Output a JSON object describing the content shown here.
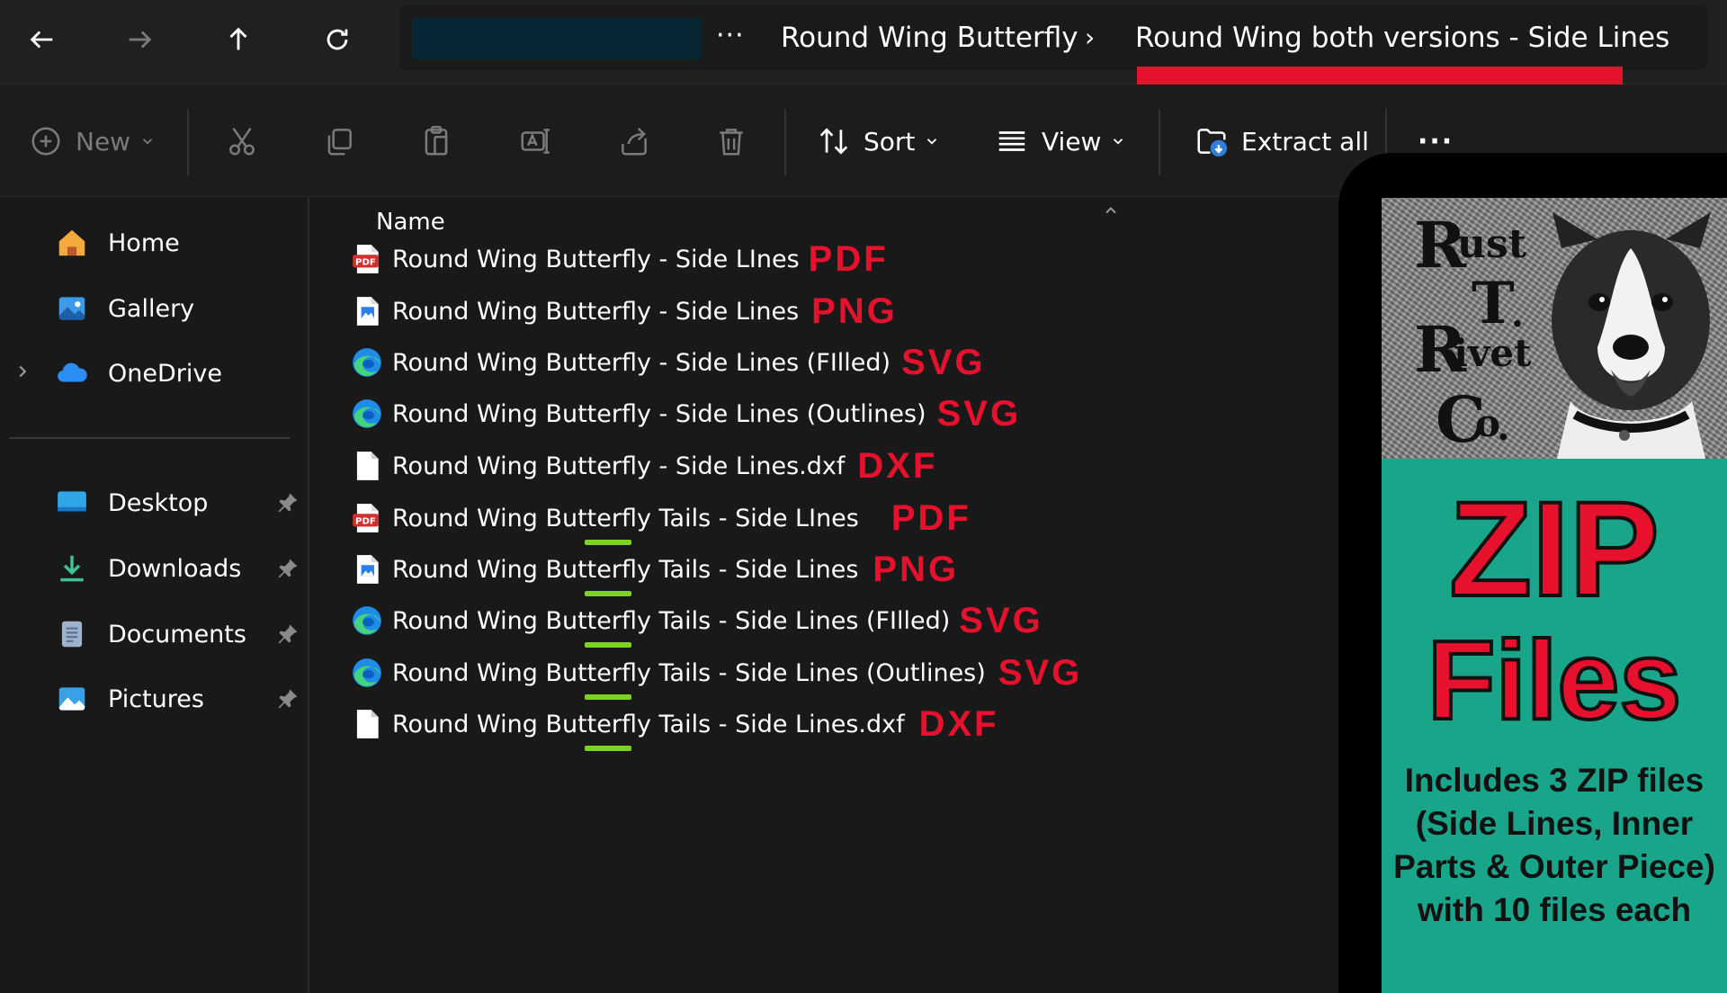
{
  "breadcrumb": {
    "overflow": "···",
    "separator": "›",
    "items": [
      "Round Wing Butterfly",
      "Round Wing both versions - Side Lines"
    ]
  },
  "toolbar": {
    "new_label": "New",
    "sort_label": "Sort",
    "view_label": "View",
    "extract_label": "Extract all",
    "more_label": "···"
  },
  "sidebar": {
    "items": [
      {
        "label": "Home",
        "icon": "home-icon"
      },
      {
        "label": "Gallery",
        "icon": "gallery-icon"
      },
      {
        "label": "OneDrive",
        "icon": "onedrive-icon"
      },
      {
        "label": "Desktop",
        "icon": "desktop-icon"
      },
      {
        "label": "Downloads",
        "icon": "downloads-icon"
      },
      {
        "label": "Documents",
        "icon": "documents-icon"
      },
      {
        "label": "Pictures",
        "icon": "pictures-icon"
      }
    ]
  },
  "file_list": {
    "column_name": "Name",
    "files": [
      {
        "name": "Round Wing Butterfly - Side LInes",
        "tag": "PDF",
        "icon": "pdf-icon"
      },
      {
        "name": "Round Wing Butterfly - Side Lines",
        "tag": "PNG",
        "icon": "image-file-icon"
      },
      {
        "name": "Round Wing Butterfly - Side Lines (FIlled)",
        "tag": "SVG",
        "icon": "edge-icon"
      },
      {
        "name": "Round Wing Butterfly - Side Lines (Outlines)",
        "tag": "SVG",
        "icon": "edge-icon"
      },
      {
        "name": "Round Wing Butterfly - Side Lines.dxf",
        "tag": "DXF",
        "icon": "blank-file-icon"
      },
      {
        "name": "Round Wing Butterfly Tails - Side LInes",
        "tag": "PDF",
        "icon": "pdf-icon"
      },
      {
        "name": "Round Wing Butterfly Tails - Side Lines",
        "tag": "PNG",
        "icon": "image-file-icon"
      },
      {
        "name": "Round Wing Butterfly Tails - Side Lines (FIlled)",
        "tag": "SVG",
        "icon": "edge-icon"
      },
      {
        "name": "Round Wing Butterfly Tails - Side Lines (Outlines)",
        "tag": "SVG",
        "icon": "edge-icon"
      },
      {
        "name": "Round Wing Butterfly Tails - Side Lines.dxf",
        "tag": "DXF",
        "icon": "blank-file-icon"
      }
    ]
  },
  "promo": {
    "logo_letters": [
      "R",
      "ust",
      "T",
      ".",
      "R",
      "ivet",
      "C",
      "o",
      "."
    ],
    "headline_1": "ZIP",
    "headline_2": "Files",
    "description": "Includes 3 ZIP files (Side Lines, Inner Parts & Outer Piece) with 10 files each"
  },
  "colors": {
    "accent_red": "#e8112d",
    "underline_green": "#7ed321",
    "promo_teal": "#18a58a"
  }
}
